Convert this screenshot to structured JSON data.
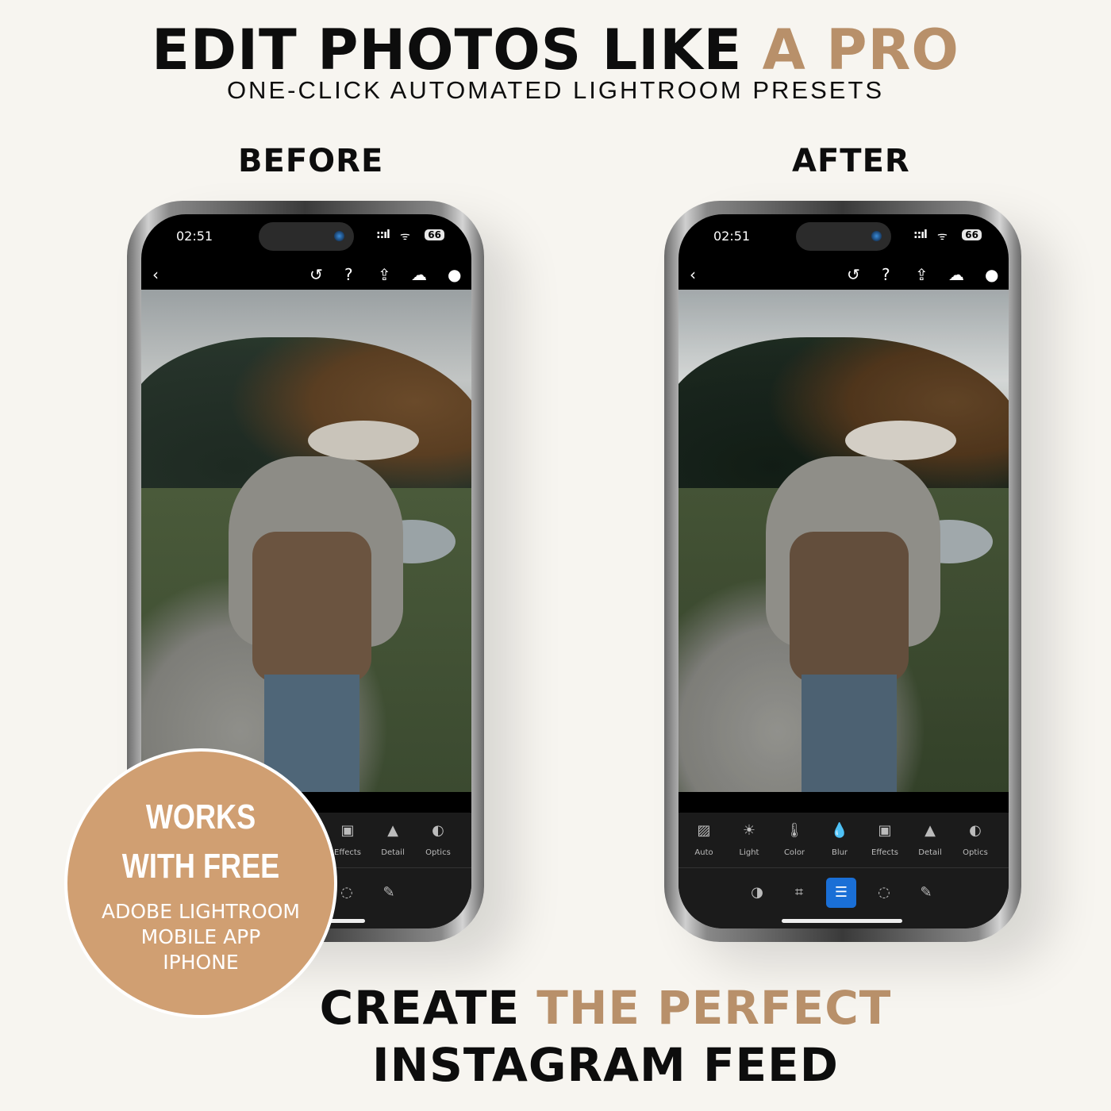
{
  "header": {
    "title_main": "EDIT PHOTOS LIKE ",
    "title_accent": "A PRO",
    "subtitle": "ONE-CLICK AUTOMATED LIGHTROOM PRESETS"
  },
  "labels": {
    "before": "BEFORE",
    "after": "AFTER"
  },
  "status": {
    "time": "02:51",
    "battery": "66",
    "signal": "::ıl"
  },
  "topbar_icons": [
    "back-icon",
    "history-icon",
    "help-icon",
    "share-icon",
    "cloud-synced-icon",
    "more-icon"
  ],
  "tools": [
    {
      "icon": "auto-icon",
      "label": "Auto"
    },
    {
      "icon": "light-icon",
      "label": "Light"
    },
    {
      "icon": "color-icon",
      "label": "Color"
    },
    {
      "icon": "blur-icon",
      "label": "Blur"
    },
    {
      "icon": "effects-icon",
      "label": "Effects"
    },
    {
      "icon": "detail-icon",
      "label": "Detail"
    },
    {
      "icon": "optics-icon",
      "label": "Optics"
    }
  ],
  "bottom_tools": [
    "presets-icon",
    "crop-icon",
    "edit-icon",
    "masking-icon",
    "healing-icon"
  ],
  "active_bottom_tool": "edit-icon",
  "badge": {
    "line1": "WORKS",
    "line2": "WITH FREE",
    "line3": "ADOBE LIGHTROOM",
    "line4": "MOBILE APP",
    "line5": "IPHONE"
  },
  "footer": {
    "line1_main": "CREATE ",
    "line1_accent": "THE PERFECT",
    "line2": "INSTAGRAM FEED"
  },
  "colors": {
    "accent": "#b8906a",
    "badge": "#d09f72",
    "background": "#f7f5f0",
    "active_tool": "#1a6fd6"
  }
}
